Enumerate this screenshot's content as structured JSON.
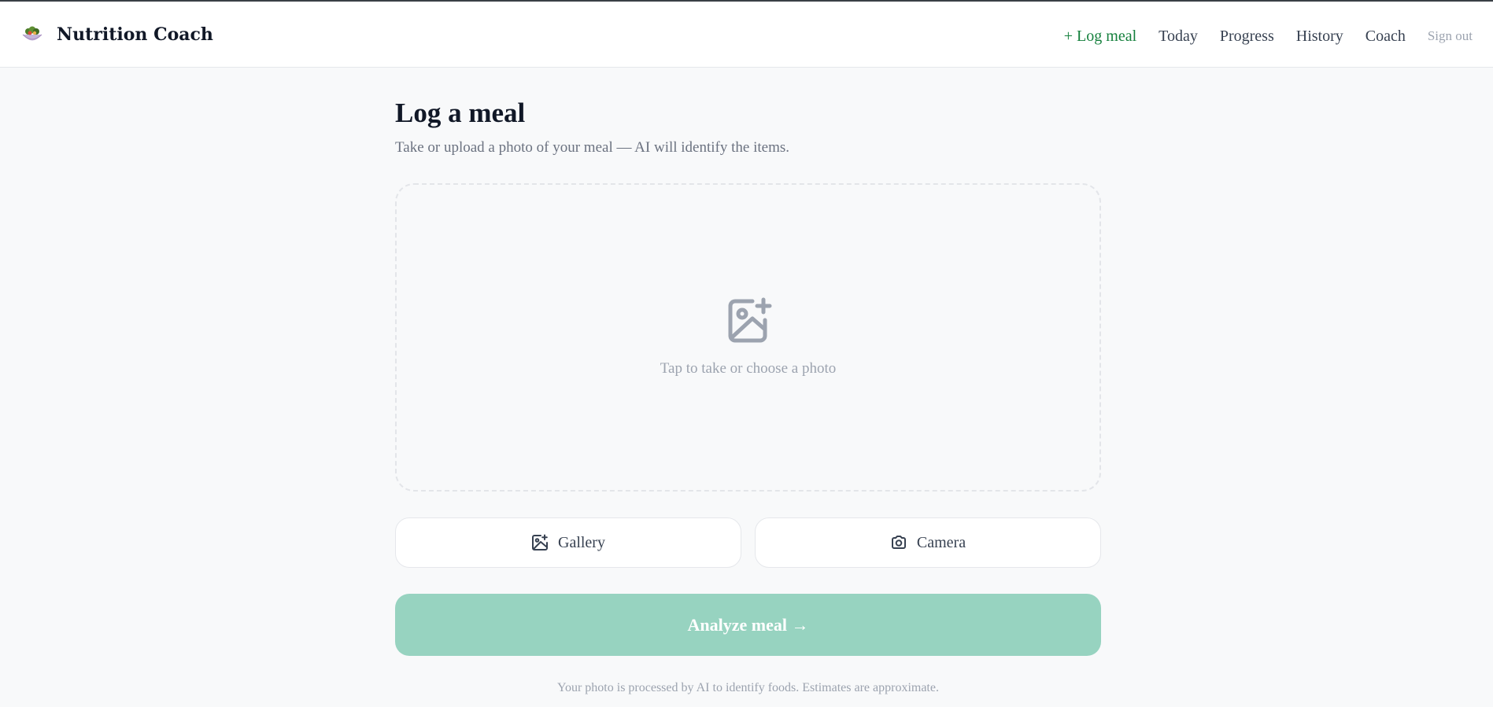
{
  "app": {
    "title": "Nutrition Coach",
    "logo_icon": "salad-bowl-icon"
  },
  "nav": {
    "log_meal": "+ Log meal",
    "today": "Today",
    "progress": "Progress",
    "history": "History",
    "coach": "Coach",
    "sign_out": "Sign out"
  },
  "page": {
    "title": "Log a meal",
    "subtitle": "Take or upload a photo of your meal — AI will identify the items."
  },
  "dropzone": {
    "icon": "image-plus-icon",
    "text": "Tap to take or choose a photo"
  },
  "sources": {
    "gallery_label": "Gallery",
    "gallery_icon": "image-sparkle-icon",
    "camera_label": "Camera",
    "camera_icon": "camera-icon"
  },
  "analyze": {
    "label": "Analyze meal →",
    "enabled": false
  },
  "footnote": "Your photo is processed by AI to identify foods. Estimates are approximate.",
  "colors": {
    "accent": "#15803d",
    "analyze_disabled": "#97d3c0",
    "muted_text": "#9ca3af"
  }
}
